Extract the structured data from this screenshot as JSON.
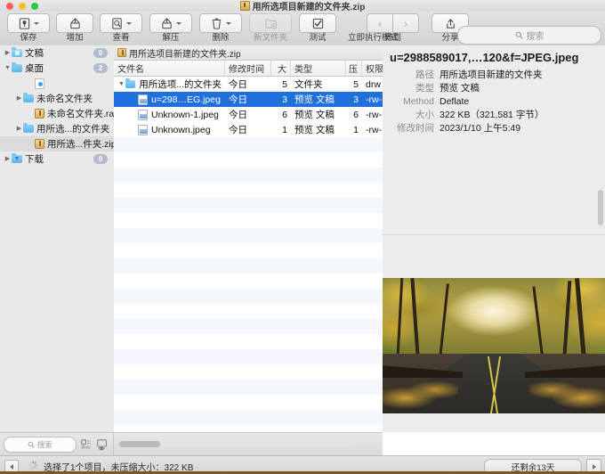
{
  "window": {
    "title": "用所选项目新建的文件夹.zip",
    "title_icon": "zip-archive-icon",
    "traffic_lights": [
      "close",
      "minimize",
      "zoom"
    ]
  },
  "toolbar": {
    "items": [
      {
        "label": "保存",
        "icon": "save-icon",
        "has_menu": true,
        "disabled": false
      },
      {
        "label": "增加",
        "icon": "add-icon",
        "has_menu": false,
        "disabled": false
      },
      {
        "label": "查看",
        "icon": "view-icon",
        "has_menu": true,
        "disabled": false
      },
      {
        "label": "解压",
        "icon": "extract-icon",
        "has_menu": true,
        "disabled": false
      },
      {
        "label": "删除",
        "icon": "trash-icon",
        "has_menu": true,
        "disabled": false
      },
      {
        "label": "新文件夹",
        "icon": "new-folder-icon",
        "has_menu": false,
        "disabled": true
      },
      {
        "label": "测试",
        "icon": "test-checkmark-icon",
        "has_menu": false,
        "disabled": false
      },
      {
        "label": "立即执行模式",
        "icon": "run-now-icon",
        "has_menu": false,
        "disabled": false
      }
    ],
    "nav": {
      "label": "转到",
      "back_icon": "chevron-left-icon",
      "forward_icon": "chevron-right-icon"
    },
    "share": {
      "label": "分享",
      "icon": "share-icon"
    },
    "search": {
      "placeholder": "搜索",
      "value": "",
      "icon": "search-icon"
    }
  },
  "sidebar": {
    "items": [
      {
        "label": "文稿",
        "icon": "folder-documents-icon",
        "badge": "0",
        "depth": 0,
        "expanded": false,
        "has_twisty": true,
        "selected": false
      },
      {
        "label": "桌面",
        "icon": "folder-desktop-icon",
        "badge": "2",
        "depth": 0,
        "expanded": true,
        "has_twisty": true,
        "selected": false
      },
      {
        "label": "",
        "icon": "ds-store-file-icon",
        "badge": "",
        "depth": 2,
        "expanded": false,
        "has_twisty": false,
        "selected": false
      },
      {
        "label": "未命名文件夹",
        "icon": "folder-icon",
        "badge": "",
        "depth": 1,
        "expanded": false,
        "has_twisty": true,
        "selected": false
      },
      {
        "label": "未命名文件夹.rar",
        "icon": "rar-archive-icon",
        "badge": "",
        "depth": 2,
        "expanded": false,
        "has_twisty": false,
        "selected": false
      },
      {
        "label": "用所选...的文件夹",
        "icon": "folder-icon",
        "badge": "",
        "depth": 1,
        "expanded": false,
        "has_twisty": true,
        "selected": false
      },
      {
        "label": "用所选...件夹.zip",
        "icon": "zip-archive-icon",
        "badge": "",
        "depth": 2,
        "expanded": false,
        "has_twisty": false,
        "selected": true
      },
      {
        "label": "下载",
        "icon": "folder-downloads-icon",
        "badge": "0",
        "depth": 0,
        "expanded": false,
        "has_twisty": true,
        "selected": false
      }
    ],
    "footer": {
      "search_placeholder": "搜索",
      "icons": [
        "layout-toggle-icon",
        "preview-toggle-icon"
      ]
    }
  },
  "file_list": {
    "tab_label": "用所选项目新建的文件夹.zip",
    "tab_icon": "zip-archive-icon",
    "columns": [
      {
        "key": "name",
        "label": "文件名",
        "align": "left"
      },
      {
        "key": "modified",
        "label": "修改时间",
        "align": "left"
      },
      {
        "key": "size",
        "label": "大",
        "align": "right"
      },
      {
        "key": "kind",
        "label": "类型",
        "align": "left"
      },
      {
        "key": "packed",
        "label": "压",
        "align": "right"
      },
      {
        "key": "perms",
        "label": "权限",
        "align": "left"
      }
    ],
    "rows": [
      {
        "name": "用所选项...的文件夹",
        "modified": "今日",
        "size": "5",
        "kind": "文件夹",
        "packed": "5",
        "perms": "drw",
        "icon": "folder-icon",
        "depth": 0,
        "twisty": "▼",
        "selected": false
      },
      {
        "name": "u=298…EG.jpeg",
        "modified": "今日",
        "size": "3",
        "kind": "预览 文稿",
        "packed": "3",
        "perms": "-rw-",
        "icon": "image-file-icon",
        "depth": 1,
        "twisty": "",
        "selected": true
      },
      {
        "name": "Unknown-1.jpeg",
        "modified": "今日",
        "size": "6",
        "kind": "预览 文稿",
        "packed": "6",
        "perms": "-rw-",
        "icon": "image-file-icon",
        "depth": 1,
        "twisty": "",
        "selected": false
      },
      {
        "name": "Unknown.jpeg",
        "modified": "今日",
        "size": "1",
        "kind": "预览 文稿",
        "packed": "1",
        "perms": "-rw-",
        "icon": "image-file-icon",
        "depth": 1,
        "twisty": "",
        "selected": false
      }
    ]
  },
  "info_panel": {
    "filename": "u=2988589017,…120&f=JPEG.jpeg",
    "fields": [
      {
        "label": "路径",
        "value": "用所选项目新建的文件夹"
      },
      {
        "label": "类型",
        "value": "预览 文稿"
      },
      {
        "label": "Method",
        "value": "Deflate"
      },
      {
        "label": "大小",
        "value": "322 KB（321,581 字节）"
      },
      {
        "label": "修改时间",
        "value": "2023/1/10 上午5:49"
      }
    ],
    "preview_alt": "autumn-road-bridge-photo"
  },
  "status_bar": {
    "left_button_icon": "sidebar-collapse-icon",
    "spinner_icon": "progress-spinner-icon",
    "message": "选择了1个项目，未压缩大小：322 KB",
    "trial_label": "还剩余13天",
    "trial_more_icon": "play-arrow-icon"
  },
  "colors": {
    "selection_blue": "#1f6fdd",
    "toolbar_gray": "#dcdcdc",
    "sidebar_gray": "#e9e9e9",
    "info_gray": "#ececec",
    "badge_blue": "#b3bccf"
  }
}
